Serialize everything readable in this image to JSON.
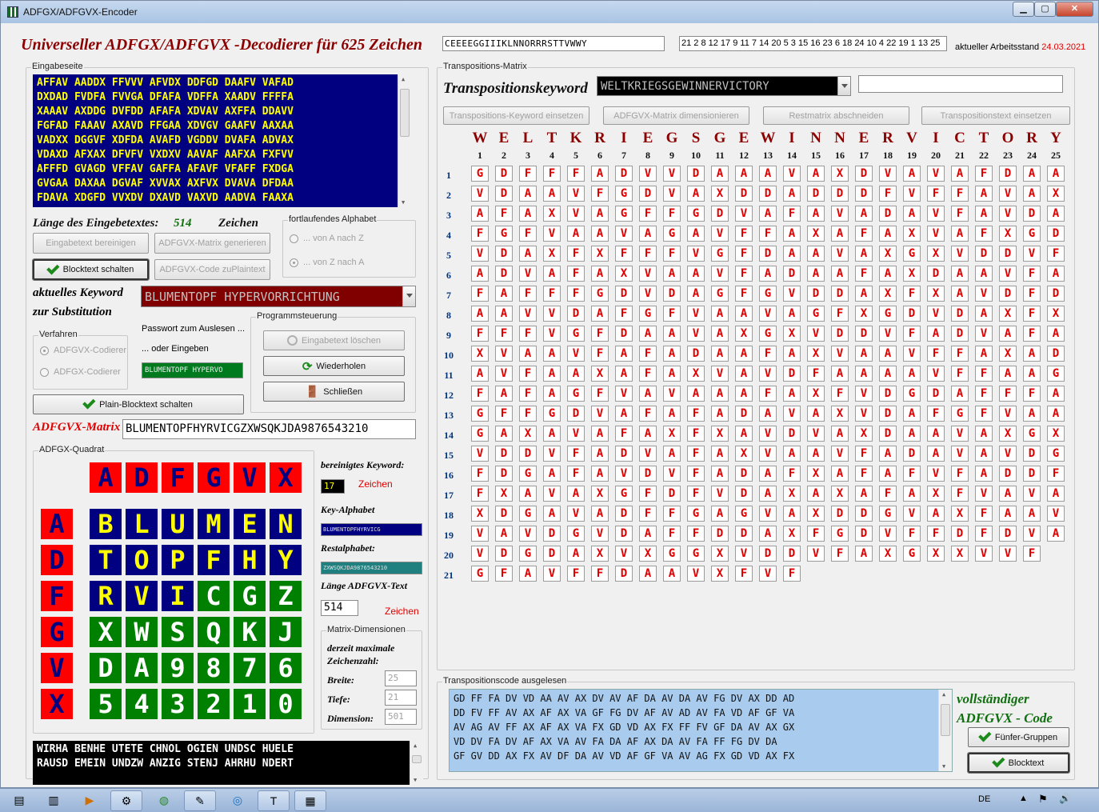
{
  "window": {
    "title": "ADFGX/ADFGVX-Encoder"
  },
  "header": {
    "main_title": "Universeller ADFGX/ADFGVX -Decodierer für 625 Zeichen",
    "sorted_key": "CEEEEGGIIIKLNNORRRSTTVWWY",
    "key_order": "21 2 8 12 17 9 11 7 14 20 5 3 15 16 23 6 18 24 10 4 22 19 1 13 25",
    "status_label": "aktueller Arbeitsstand",
    "status_date": "24.03.2021"
  },
  "input_page": {
    "label": "Eingabeseite",
    "lines": [
      "AFFAV AADDX FFVVV AFVDX DDFGD DAAFV VAFAD",
      "DXDAD FVDFA FVVGA DFAFA VDFFA XAADV FFFFA",
      "XAAAV AXDDG DVFDD AFAFA XDVAV AXFFA DDAVV",
      "FGFAD FAAAV AXAVD FFGAA XDVGV GAAFV AAXAA",
      "VADXX DGGVF XDFDA AVAFD VGDDV DVAFA ADVAX",
      "VDAXD AFXAX DFVFV VXDXV AAVAF AAFXA FXFVV",
      "AFFFD GVAGD VFFAV GAFFA AFAVF VFAFF FXDGA",
      "GVGAA DAXAA DGVAF XVVAX AXFVX DVAVA DFDAA",
      "FDAVA XDGFD VVXDV DXAVD VAXVD AADVA FAAXA"
    ],
    "length_label": "Länge des Eingebetextes:",
    "length_value": "514",
    "length_unit": "Zeichen",
    "btn_clean": "Eingabetext bereinigen",
    "btn_block": "Blocktext schalten",
    "btn_gen_matrix": "ADFGVX-Matrix generieren",
    "btn_to_plain": "ADFGVX-Code zuPlaintext"
  },
  "alphabet_group": {
    "label": "fortlaufendes Alphabet",
    "opt_a_z": "... von A nach Z",
    "opt_z_a": "... von Z nach A"
  },
  "keyword": {
    "label1": "aktuelles Keyword",
    "label2": "zur Substitution",
    "value": "BLUMENTOPF HYPERVORRICHTUNG"
  },
  "procedure": {
    "label": "Verfahren",
    "opt_adfgvx": "ADFGVX-Codierer",
    "opt_adfgx": "ADFGX-Codierer"
  },
  "password": {
    "label": "Passwort zum Auslesen ...",
    "label2": "... oder Eingeben",
    "value": "BLUMENTOPF HYPERVO"
  },
  "program_control": {
    "label": "Programmsteuerung",
    "btn_clear": "Eingabetext löschen",
    "btn_repeat": "Wiederholen",
    "btn_close": "Schließen"
  },
  "btn_plain_block": "Plain-Blocktext schalten",
  "matrix_label": "ADFGVX-Matrix",
  "matrix_value": "BLUMENTOPFHYRVICGZXWSQKJDA9876543210",
  "square": {
    "label": "ADFGX-Quadrat",
    "header": [
      "A",
      "D",
      "F",
      "G",
      "V",
      "X"
    ],
    "rows": [
      [
        "B",
        "L",
        "U",
        "M",
        "E",
        "N"
      ],
      [
        "T",
        "O",
        "P",
        "F",
        "H",
        "Y"
      ],
      [
        "R",
        "V",
        "I",
        "C",
        "G",
        "Z"
      ],
      [
        "X",
        "W",
        "S",
        "Q",
        "K",
        "J"
      ],
      [
        "D",
        "A",
        "9",
        "8",
        "7",
        "6"
      ],
      [
        "5",
        "4",
        "3",
        "2",
        "1",
        "0"
      ]
    ]
  },
  "info": {
    "clean_kw_label": "bereinigtes Keyword:",
    "clean_kw_value": "17",
    "clean_kw_unit": "Zeichen",
    "key_alpha_label": "Key-Alphabet",
    "key_alpha_value": "BLUMENTOPFHYRVICG",
    "rest_alpha_label": "Restalphabet:",
    "rest_alpha_value": "ZXWSQKJDA9876543210",
    "len_label": "Länge ADFGVX-Text",
    "len_value": "514",
    "len_unit": "Zeichen"
  },
  "dims": {
    "label": "Matrix-Dimensionen",
    "max_label1": "derzeit maximale",
    "max_label2": "Zeichenzahl:",
    "width_label": "Breite:",
    "width_value": "25",
    "depth_label": "Tiefe:",
    "depth_value": "21",
    "dim_label": "Dimension:",
    "dim_value": "501"
  },
  "output_text": {
    "lines": [
      "WIRHA BENHE UTETE CHNOL OGIEN UNDSC HUELE",
      "RAUSD EMEIN UNDZW ANZIG STENJ AHRHU NDERT"
    ]
  },
  "transposition": {
    "label": "Transpositions-Matrix",
    "title": "Transpositionskeyword",
    "keyword": "WELTKRIEGSGEWINNERVICTORY",
    "extra_value": "",
    "btn_insert_kw": "Transpositions-Keyword einsetzen",
    "btn_dimension": "ADFGVX-Matrix dimensionieren",
    "btn_cut_rest": "Restmatrix abschneiden",
    "btn_insert_text": "Transpositionstext einsetzen",
    "key_letters": [
      "W",
      "E",
      "L",
      "T",
      "K",
      "R",
      "I",
      "E",
      "G",
      "S",
      "G",
      "E",
      "W",
      "I",
      "N",
      "N",
      "E",
      "R",
      "V",
      "I",
      "C",
      "T",
      "O",
      "R",
      "Y"
    ],
    "col_numbers": [
      "1",
      "2",
      "3",
      "4",
      "5",
      "6",
      "7",
      "8",
      "9",
      "10",
      "11",
      "12",
      "13",
      "14",
      "15",
      "16",
      "17",
      "18",
      "19",
      "20",
      "21",
      "22",
      "23",
      "24",
      "25"
    ],
    "rows": [
      "GDFFFADVVDAAAVAXDVAVAFDAA",
      "VDAAVFGDVAXDDADDDFVFFAVAX",
      "AFAXVAGFFGDVAFAVADAVFAVDA",
      "FGFVAAVAGAVFFAXAFAXVAFXGD",
      "VDAXFXFFFVGFDAAVAXGXVDDVF",
      "ADVAFAXVAAVFADAAFAXDAAVFA",
      "FAFFFGDVDAGFGVDDAXFXAVDFD",
      "AAVVDAFGFVAAVAGFXGDVDAXFX",
      "FFFVGFDAAVAXGXVDDVFADVAFA",
      "XVAAVFAFADAAFAXVAAVFFAXAD",
      "AVFAAXAFAXVAVDFAAAAVFFAAG",
      "FAFAGFVAVAAAFAXFVDGDAFFFA",
      "GFFGDVAFAFADAVAXVDAFGFVAA",
      "GAXAVAFAXFXAVDVAXDAAVAXGX",
      "VDDVFADVAFAXVAAVFADAVAVDG",
      "FDGAFAVDVFADAFXAFAFVFADDF",
      "FXAVAXGFDFVDAXAXAFAXFVAVA",
      "XDGAVADFFGAGVAXDDGVAXFAAV",
      "VAVDGVDAFFDDAXFGDVFFDFDVA",
      "VDGDAXVXGGXVDDVFAXGXXVVF",
      "GFAVFFDAAVXFVF"
    ]
  },
  "code_readout": {
    "label": "Transpositionscode ausgelesen",
    "lines": [
      "GD FF FA DV VD AA AV AX DV AV AF DA AV DA AV FG DV AX DD AD",
      "DD FV FF AV AX AF AX VA GF FG DV AF AV AD AV FA VD AF GF VA",
      "AV AG AV FF AX AF AX VA FX GD VD AX FX FF FV GF DA AV AX GX",
      "VD DV FA DV AF AX VA AV FA DA AF AX DA AV FA FF FG DV DA",
      "GF GV DD AX FX AV DF DA AV VD AF GF VA AV AG FX GD VD AX FX"
    ],
    "complete_label1": "vollständiger",
    "complete_label2": "ADFGVX - Code",
    "btn_groups": "Fünfer-Gruppen",
    "btn_blocktext": "Blocktext"
  },
  "taskbar": {
    "lang": "DE"
  },
  "colors": {
    "navy": "#000080",
    "red": "#ff0000",
    "green": "#008000",
    "dark_red": "#8b0000",
    "yellow": "#ffff00",
    "light_blue": "#a8cbee"
  }
}
